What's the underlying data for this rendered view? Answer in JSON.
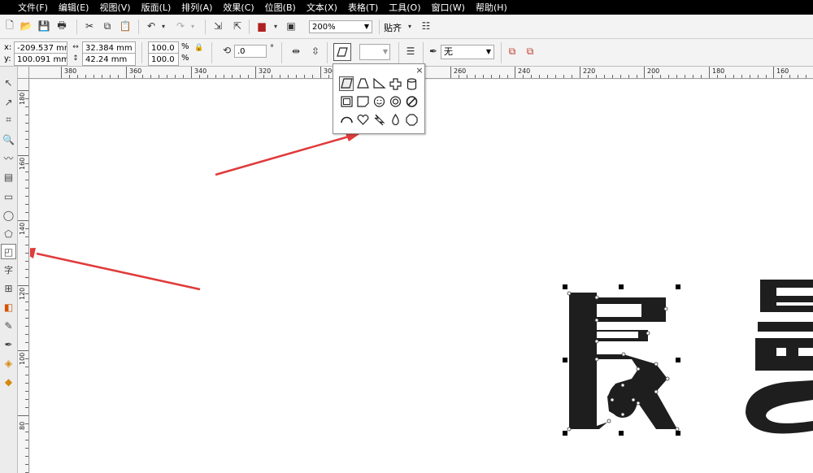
{
  "menu": [
    "文件(F)",
    "编辑(E)",
    "视图(V)",
    "版面(L)",
    "排列(A)",
    "效果(C)",
    "位图(B)",
    "文本(X)",
    "表格(T)",
    "工具(O)",
    "窗口(W)",
    "帮助(H)"
  ],
  "toolbar": {
    "zoom_value": "200%",
    "snap_label": "贴齐"
  },
  "properties": {
    "x_label": "x:",
    "x_value": "-209.537 mm",
    "y_label": "y:",
    "y_value": "100.091 mm",
    "width_value": "32.384 mm",
    "height_value": "42.24 mm",
    "scale_x": "100.0",
    "scale_y": "100.0",
    "percent": "%",
    "rotation": ".0",
    "degree": "°",
    "outline_value": "无"
  },
  "ruler_h": [
    "380",
    "360",
    "340",
    "320",
    "300",
    "260",
    "240",
    "220",
    "200",
    "180",
    "160"
  ],
  "ruler_v": [
    "180",
    "160",
    "140",
    "120",
    "100",
    "80"
  ],
  "toolbox_text_tool": "字",
  "flyout": {
    "close": "×",
    "shapes": [
      "parallelogram-icon",
      "trapezoid-icon",
      "right-triangle-icon",
      "cross-icon",
      "cylinder-icon",
      "frame-icon",
      "folded-corner-icon",
      "smiley-icon",
      "donut-icon",
      "no-sign-icon",
      "arc-icon",
      "heart-icon",
      "lightning-icon",
      "teardrop-icon",
      "octagon-icon"
    ]
  },
  "colors": {
    "arrow": "#e03b3b",
    "glyph": "#1e1e1e",
    "menubar": "#000000"
  }
}
